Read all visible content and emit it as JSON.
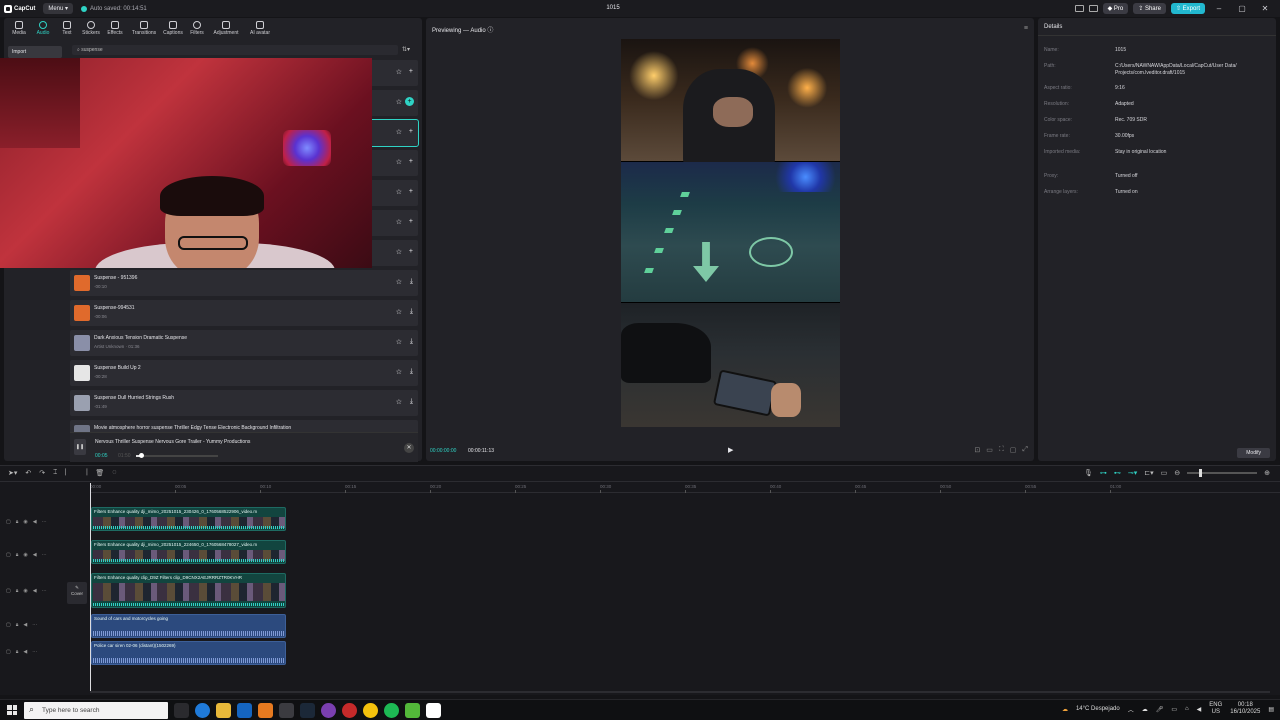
{
  "app": {
    "logo": "CapCut",
    "menu_label": "Menu",
    "autosave": "Auto saved: 00:14:51",
    "project_title": "1015",
    "pro_label": "Pro",
    "share_label": "Share",
    "export_label": "Export"
  },
  "toolbar": {
    "items": [
      "Media",
      "Audio",
      "Text",
      "Stickers",
      "Effects",
      "Transitions",
      "Captions",
      "Filters",
      "Adjustment",
      "AI avatar"
    ],
    "active": "Audio"
  },
  "left_panel": {
    "import_label": "Import",
    "search_value": "suspense"
  },
  "audio_items": [
    {
      "title": "Suspense - 951396",
      "subtitle": "·00:10",
      "color": "#e06a2c"
    },
    {
      "title": "Suspense-994531",
      "subtitle": "·00:06",
      "color": "#e06a2c"
    },
    {
      "title": "Dark Anxious Tension Dramatic Suspense",
      "subtitle": "Artist Unknown · 01:36",
      "color": "#8a8fa8"
    },
    {
      "title": "Suspense Build Up 2",
      "subtitle": "·00:28",
      "color": "#e6e6e6"
    },
    {
      "title": "Suspense Dull Hurried Strings Rush",
      "subtitle": "·01:49",
      "color": "#9aa0b0"
    },
    {
      "title": "Movie atmosphere horror suspense Thriller Edgy Tense Electronic Background Infiltration",
      "subtitle": "·01:40",
      "color": "#6f7486"
    }
  ],
  "now_playing": {
    "title": "Nervous Thriller Suspense Nervous Gore Trailer - Yummy Productions",
    "current": "00:05",
    "total": "01:50",
    "progress": 0.06
  },
  "preview": {
    "title": "Previewing — Audio",
    "time_current": "00:00:00:00",
    "time_total": "00:00:11:13"
  },
  "details": {
    "header": "Details",
    "rows": [
      {
        "key": "Name:",
        "value": "1015"
      },
      {
        "key": "Path:",
        "value": "C:/Users/NAWNAW/AppData/Local/CapCut/User Data/ Projects/com.lveditor.draft/1015"
      },
      {
        "key": "Aspect ratio:",
        "value": "9:16"
      },
      {
        "key": "Resolution:",
        "value": "Adapted"
      },
      {
        "key": "Color space:",
        "value": "Rec. 709 SDR"
      },
      {
        "key": "Frame rate:",
        "value": "30.00fps"
      },
      {
        "key": "Imported media:",
        "value": "Stay in original location"
      },
      {
        "key": "Proxy:",
        "value": "Turned off"
      },
      {
        "key": "Arrange layers:",
        "value": "Turned on"
      }
    ],
    "modify_label": "Modify"
  },
  "timeline": {
    "ruler": [
      "00:00",
      "00:05",
      "00:10",
      "00:15",
      "00:20",
      "00:25",
      "00:30",
      "00:35",
      "00:40",
      "00:45",
      "00:50",
      "00:55",
      "01:00"
    ],
    "cover_label": "Cover",
    "video_clips": [
      "Filters  Enhance quality  dji_mimo_20251015_230426_0_1760568522906_video.m",
      "Filters  Enhance quality  dji_mimo_20251015_224650_0_1760568478027_video.m",
      "Filters  Enhance quality  clip_D9Z  Filters  clip_D9CNX2AEJRRRZTR0KVHR"
    ],
    "audio_clips": [
      "Sound of cars and motorcycles going",
      "Police car siren 02-06 (distant)(1502269)"
    ]
  },
  "taskbar": {
    "search_placeholder": "Type here to search",
    "weather": "14°C  Despejado",
    "lang_top": "ENG",
    "lang_bottom": "US",
    "time": "00:18",
    "date": "16/10/2025"
  }
}
